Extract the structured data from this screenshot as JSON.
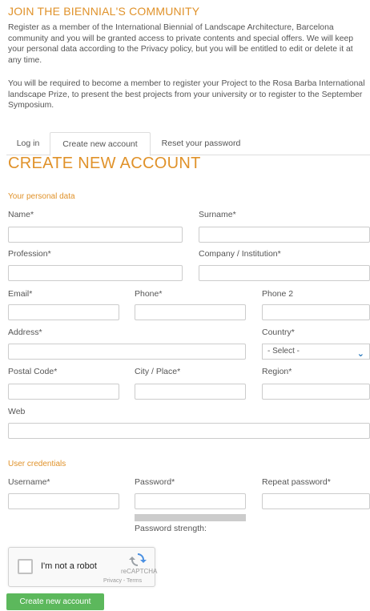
{
  "intro": {
    "title": "JOIN THE BIENNIAL'S COMMUNITY",
    "para1": "Register as a member of the International Biennial of Landscape Architecture, Barcelona community and you will be granted access to private contents and special offers. We will keep your personal data according to the Privacy policy, but you will be entitled to edit or delete it at any time.",
    "para2": "You will be required to become a member to register your Project to the Rosa Barba International landscape Prize, to present the best projects from your university or to register to the September Symposium."
  },
  "tabs": [
    "Log in",
    "Create new account",
    "Reset your password"
  ],
  "page_title": "CREATE NEW ACCOUNT",
  "personal": {
    "section_label": "Your personal data",
    "name": "Name*",
    "surname": "Surname*",
    "profession": "Profession*",
    "company": "Company / Institution*",
    "email": "Email*",
    "phone": "Phone*",
    "phone2": "Phone 2",
    "address": "Address*",
    "country": "Country*",
    "country_value": "- Select -",
    "postal": "Postal Code*",
    "city": "City / Place*",
    "region": "Region*",
    "web": "Web"
  },
  "credentials": {
    "section_label": "User credentials",
    "username": "Username*",
    "password": "Password*",
    "repeat": "Repeat password*",
    "strength_label": "Password strength:"
  },
  "captcha": {
    "label": "I'm not a robot",
    "brand": "reCAPTCHA",
    "terms": "Privacy - Terms"
  },
  "submit_label": "Create new account",
  "colors": {
    "accent": "#e0922a",
    "button": "#5cb85c",
    "link_blue": "#1a6fb8"
  }
}
